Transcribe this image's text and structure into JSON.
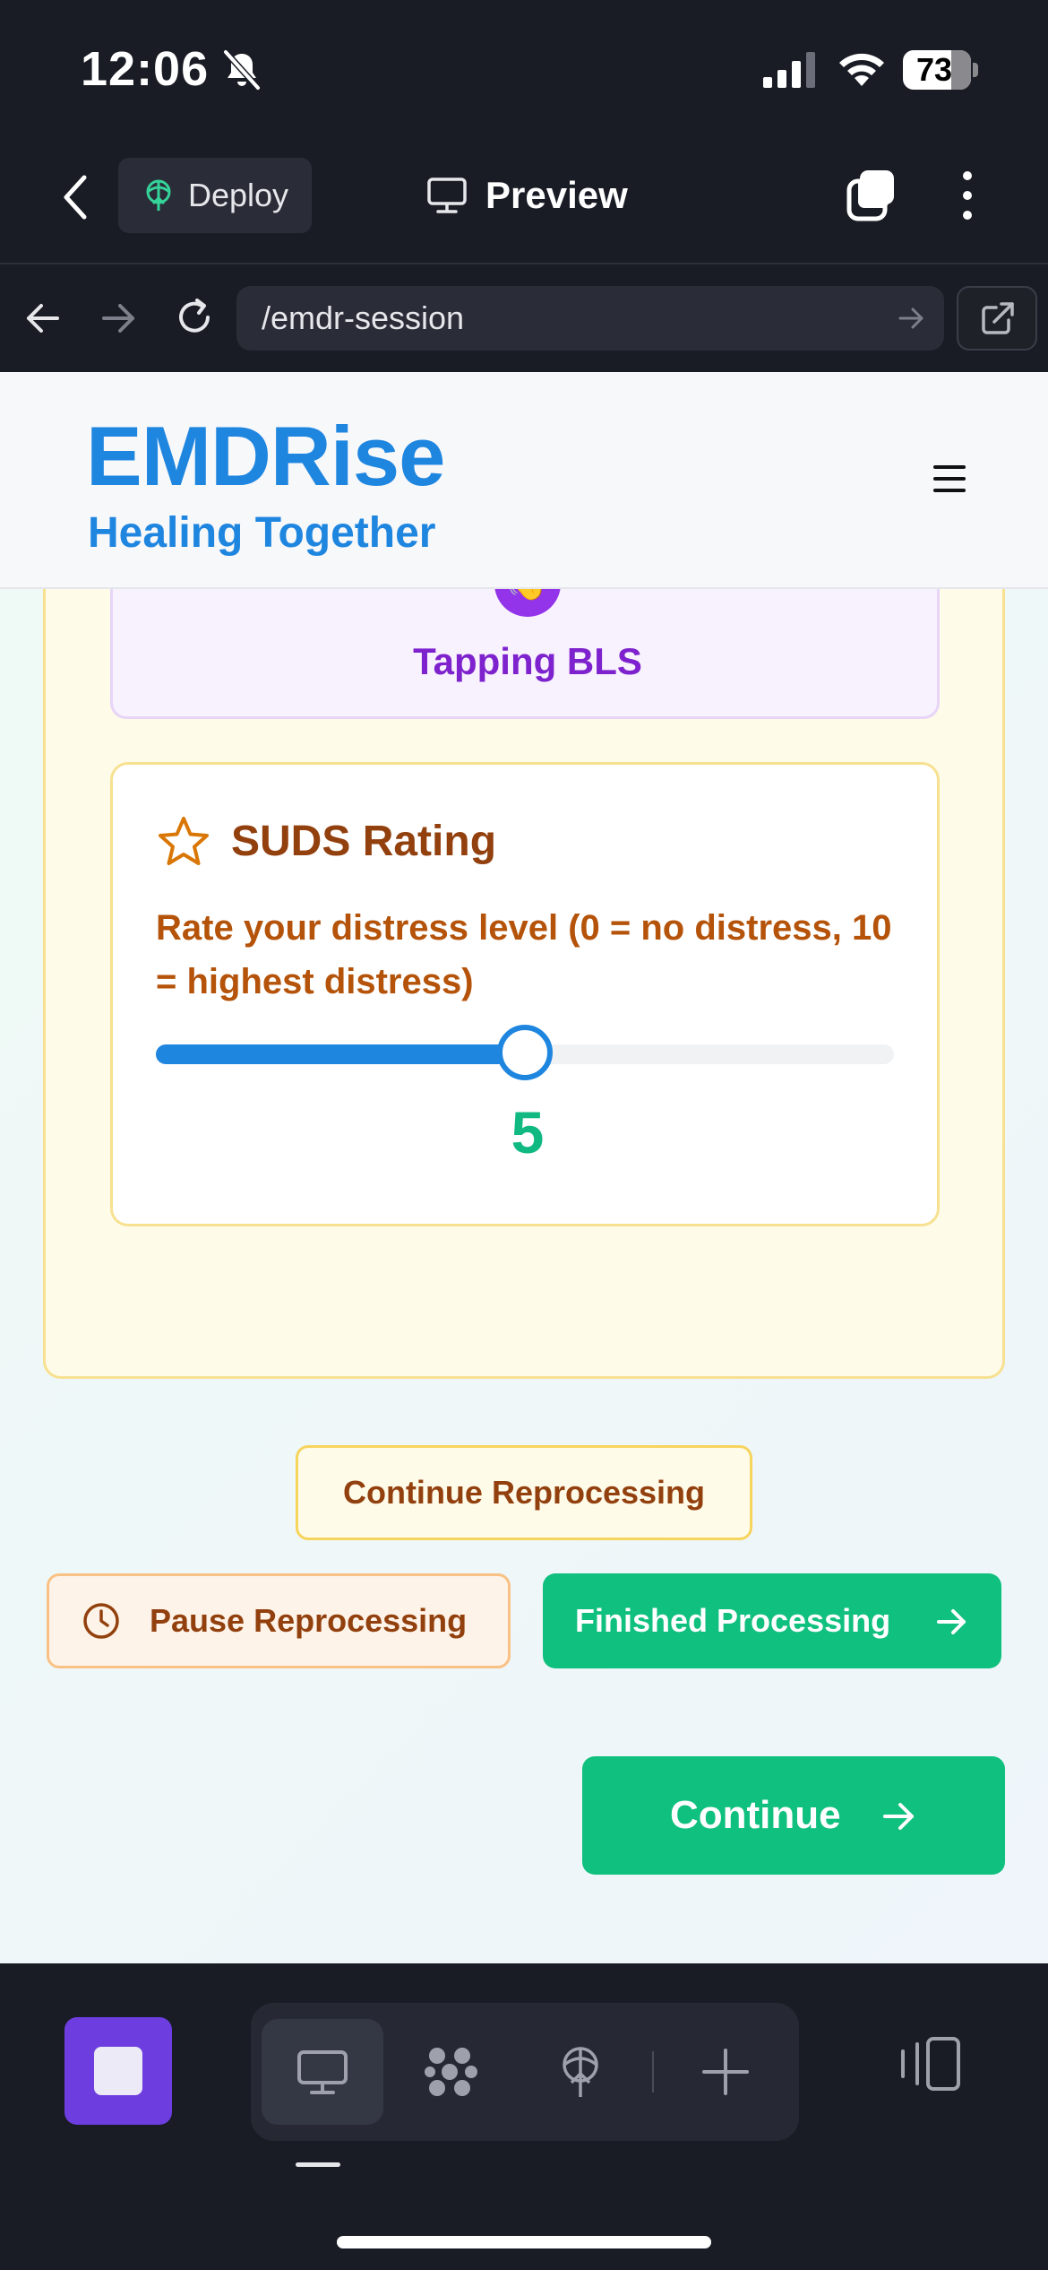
{
  "status_bar": {
    "time": "12:06",
    "battery": "73"
  },
  "app_toolbar": {
    "deploy_label": "Deploy",
    "preview_label": "Preview"
  },
  "browser": {
    "url": "/emdr-session"
  },
  "site": {
    "brand_name": "EMDRise",
    "tagline": "Healing Together"
  },
  "bls": {
    "icon": "👋",
    "label": "Tapping BLS"
  },
  "suds": {
    "title": "SUDS Rating",
    "description": "Rate your distress level (0 = no distress, 10 = highest distress)",
    "min": 0,
    "max": 10,
    "value": 5,
    "value_label": "5"
  },
  "actions": {
    "continue_reprocessing": "Continue Reprocessing",
    "pause_reprocessing": "Pause Reprocessing",
    "finished_processing": "Finished Processing",
    "continue": "Continue"
  },
  "colors": {
    "brand_blue": "#1f86e0",
    "success_green": "#10c07f",
    "amber_text": "#92400e",
    "purple": "#9333ea",
    "stop_purple": "#6d3de0"
  },
  "icons": {
    "status": [
      "bell-off-icon",
      "signal-icon",
      "wifi-icon",
      "battery-icon"
    ],
    "toolbar": [
      "chevron-left-icon",
      "deploy-icon",
      "monitor-icon",
      "tabs-icon",
      "more-vertical-icon"
    ],
    "browser": [
      "arrow-left-icon",
      "arrow-right-icon",
      "reload-icon",
      "arrow-right-icon",
      "external-link-icon"
    ],
    "bottom": [
      "stop-icon",
      "monitor-icon",
      "grid-icon",
      "deploy-icon",
      "plus-icon",
      "sidebar-icon"
    ]
  }
}
